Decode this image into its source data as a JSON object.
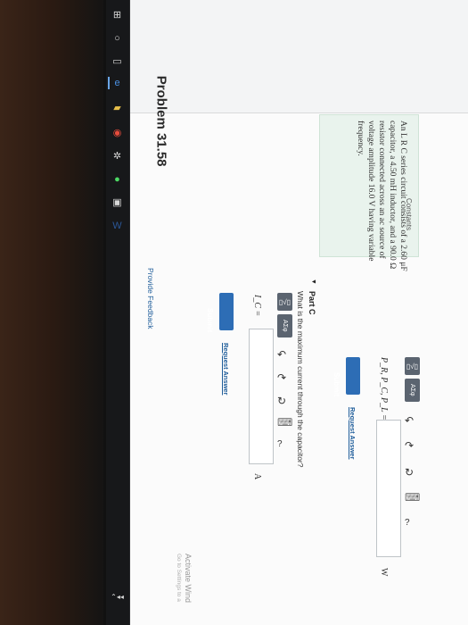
{
  "problem": {
    "title": "Problem 31.58"
  },
  "constants": {
    "title": "Constants",
    "lines": [
      "An L R C series circuit consists of a 2.60 μF",
      "capacitor, a 4.50 mH inductor, and a 90.0 Ω",
      "resistor connected across an ac source of",
      "voltage amplitude 16.0 V having variable",
      "frequency."
    ]
  },
  "toolbar": {
    "template": "▯√▯",
    "greek": "ΑΣφ",
    "undo": "↶",
    "redo": "↷",
    "reset": "↻",
    "keyboard": "⌨",
    "help": "?"
  },
  "part_b": {
    "label": "P_R, P_C, P_L =",
    "unit": "W",
    "submit": "Submit",
    "request": "Request Answer"
  },
  "part_c": {
    "marker": "▼",
    "title": "Part C",
    "question": "What is the maximum current through the capacitor?",
    "label": "I_C =",
    "unit": "A",
    "submit": "Submit",
    "request": "Request Answer"
  },
  "feedback": "Provide Feedback",
  "watermark": {
    "main": "Activate Wind",
    "sub": "Go to Settings to a"
  }
}
